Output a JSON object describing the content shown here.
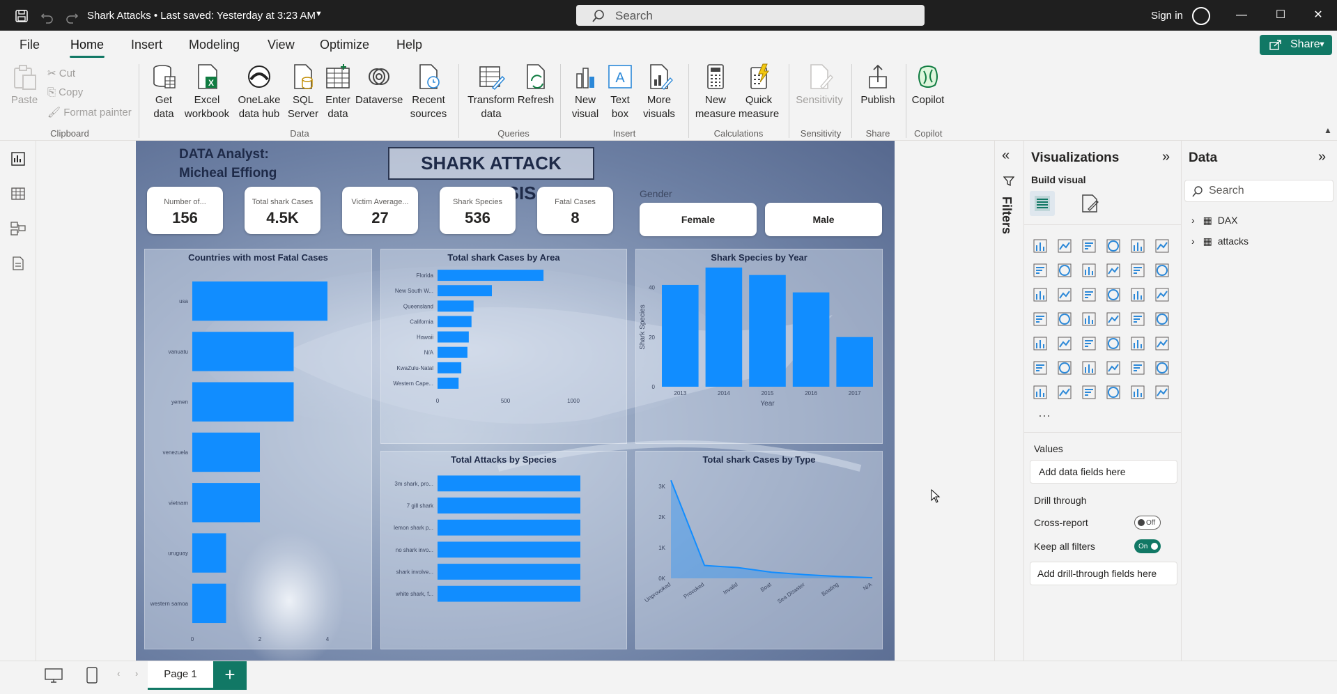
{
  "titlebar": {
    "title": "Shark Attacks • Last saved: Yesterday at 3:23 AM",
    "search_placeholder": "Search",
    "signin": "Sign in"
  },
  "menu": [
    "File",
    "Home",
    "Insert",
    "Modeling",
    "View",
    "Optimize",
    "Help"
  ],
  "share_label": "Share",
  "ribbon": {
    "clipboard": {
      "paste": "Paste",
      "cut": "Cut",
      "copy": "Copy",
      "format_painter": "Format painter",
      "group": "Clipboard"
    },
    "data": {
      "get_data": "Get data",
      "excel": "Excel workbook",
      "onelake": "OneLake data hub",
      "sql": "SQL Server",
      "enter": "Enter data",
      "dataverse": "Dataverse",
      "recent": "Recent sources",
      "group": "Data"
    },
    "queries": {
      "transform": "Transform data",
      "refresh": "Refresh",
      "group": "Queries"
    },
    "insert": {
      "new_visual": "New visual",
      "text_box": "Text box",
      "more_visuals": "More visuals",
      "group": "Insert"
    },
    "calculations": {
      "new_measure": "New measure",
      "quick_measure": "Quick measure",
      "group": "Calculations"
    },
    "sensitivity": {
      "label": "Sensitivity",
      "group": "Sensitivity"
    },
    "share": {
      "publish": "Publish",
      "group": "Share"
    },
    "copilot": {
      "label": "Copilot",
      "group": "Copilot"
    }
  },
  "report": {
    "analyst_line1": "DATA Analyst:",
    "analyst_line2": "Micheal Effiong",
    "title": "SHARK ATTACK ANALYSIS",
    "cards": [
      {
        "label": "Number of...",
        "value": "156"
      },
      {
        "label": "Total shark Cases",
        "value": "4.5K"
      },
      {
        "label": "Victim Average...",
        "value": "27"
      },
      {
        "label": "Shark Species",
        "value": "536"
      },
      {
        "label": "Fatal Cases",
        "value": "8"
      }
    ],
    "gender_title": "Gender",
    "gender": [
      "Female",
      "Male"
    ]
  },
  "chart_data": [
    {
      "type": "bar",
      "title": "Countries with most Fatal Cases",
      "orientation": "horizontal",
      "categories": [
        "usa",
        "vanuatu",
        "yemen",
        "venezuela",
        "vietnam",
        "uruguay",
        "western samoa"
      ],
      "values": [
        4,
        3,
        3,
        2,
        2,
        1,
        1
      ],
      "xlim": [
        0,
        4
      ],
      "xticks": [
        "0",
        "2",
        "4"
      ]
    },
    {
      "type": "bar",
      "title": "Total shark Cases by Area",
      "orientation": "horizontal",
      "categories": [
        "Florida",
        "New South W...",
        "Queensland",
        "California",
        "Hawaii",
        "N/A",
        "KwaZulu-Natal",
        "Western Cape..."
      ],
      "values": [
        780,
        400,
        265,
        250,
        230,
        220,
        175,
        155
      ],
      "xlim": [
        0,
        1000
      ],
      "xticks": [
        "0",
        "500",
        "1000"
      ]
    },
    {
      "type": "bar",
      "title": "Shark Species by Year",
      "orientation": "vertical",
      "categories": [
        "2013",
        "2014",
        "2015",
        "2016",
        "2017"
      ],
      "values": [
        41,
        48,
        45,
        38,
        20
      ],
      "ylim": [
        0,
        48
      ],
      "yticks": [
        "0",
        "20",
        "40"
      ],
      "xlabel": "Year",
      "ylabel": "Shark Species"
    },
    {
      "type": "bar",
      "title": "Total Attacks by Species",
      "orientation": "horizontal",
      "categories": [
        "3m shark, pro...",
        "7 gill shark",
        "lemon shark p...",
        "no shark invo...",
        "shark involve...",
        "white shark, f..."
      ],
      "values": [
        1,
        1,
        1,
        1,
        1,
        1
      ],
      "xlim": [
        0,
        1
      ]
    },
    {
      "type": "area",
      "title": "Total shark Cases by Type",
      "categories": [
        "Unprovoked",
        "Provoked",
        "Invalid",
        "Boat",
        "Sea Disaster",
        "Boating",
        "N/A"
      ],
      "values": [
        3200,
        420,
        350,
        200,
        120,
        60,
        20
      ],
      "ylim": [
        0,
        3500
      ],
      "yticks": [
        "0K",
        "1K",
        "2K",
        "3K"
      ]
    }
  ],
  "visualizations": {
    "title": "Visualizations",
    "build_visual": "Build visual",
    "values_label": "Values",
    "values_placeholder": "Add data fields here",
    "drill_through": "Drill through",
    "cross_report": "Cross-report",
    "cross_report_state": "Off",
    "keep_filters": "Keep all filters",
    "keep_filters_state": "On",
    "drill_placeholder": "Add drill-through fields here"
  },
  "filters_label": "Filters",
  "data_pane": {
    "title": "Data",
    "search_placeholder": "Search",
    "tables": [
      "DAX",
      "attacks"
    ]
  },
  "pagebar": {
    "page": "Page 1",
    "add": "+"
  },
  "colors": {
    "accent": "#117865",
    "bar": "#118dff",
    "title_bar": "#1f1f1f"
  }
}
